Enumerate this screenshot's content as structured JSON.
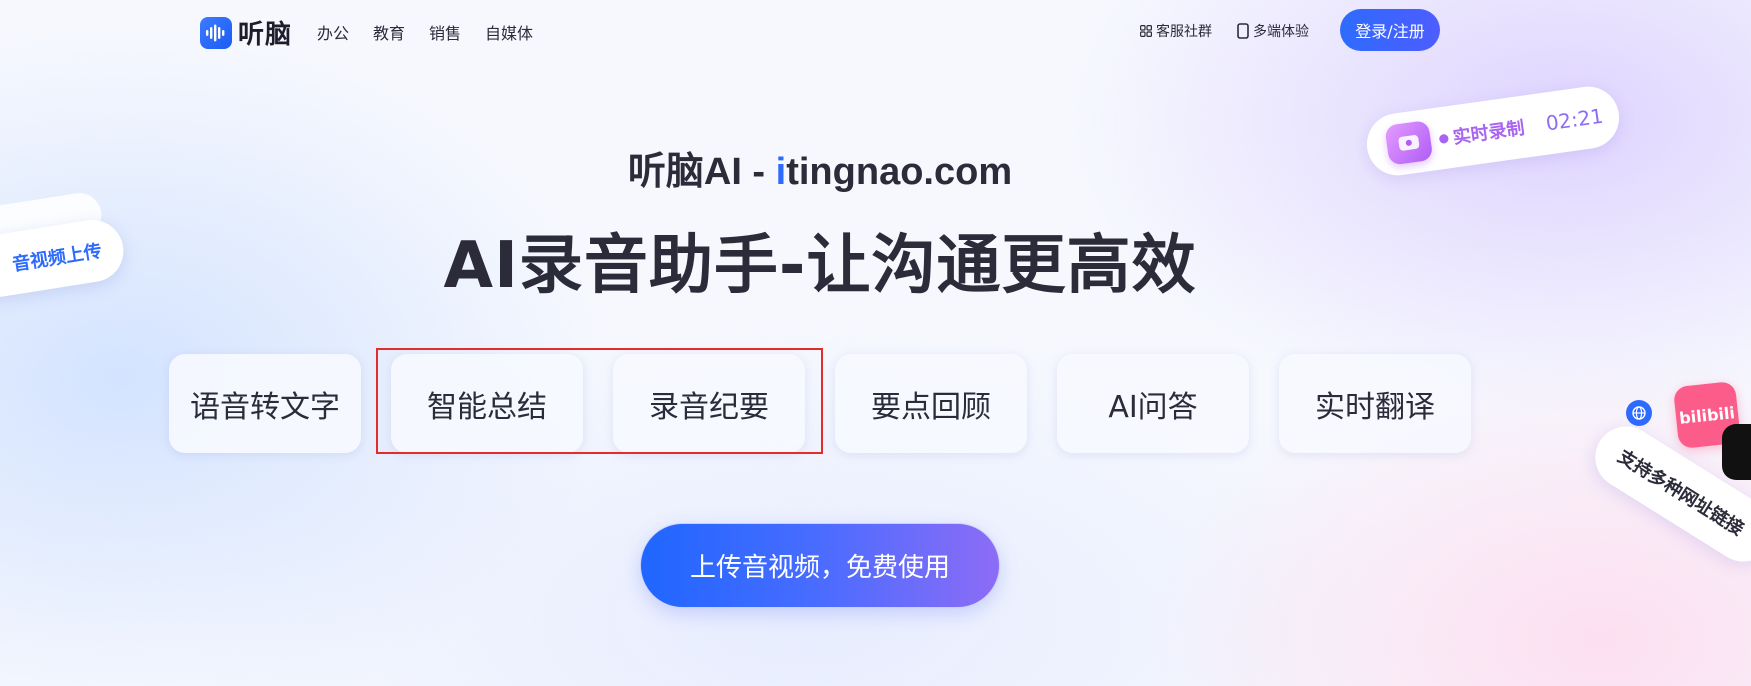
{
  "header": {
    "logo_text": "听脑",
    "nav": [
      "办公",
      "教育",
      "销售",
      "自媒体"
    ],
    "community": {
      "label": "客服社群",
      "icon": "grid-icon"
    },
    "multi_device": {
      "label": "多端体验",
      "icon": "phone-icon"
    },
    "login_label": "登录/注册"
  },
  "hero": {
    "site_title_prefix": "听脑AI - ",
    "site_title_accent": "i",
    "site_title_rest": "tingnao.com",
    "headline": "AI录音助手-让沟通更高效"
  },
  "features": [
    {
      "label": "语音转文字"
    },
    {
      "label": "智能总结"
    },
    {
      "label": "录音纪要"
    },
    {
      "label": "要点回顾"
    },
    {
      "label": "AI问答"
    },
    {
      "label": "实时翻译"
    }
  ],
  "cta_label": "上传音视频，免费使用",
  "floats": {
    "upload_label": "音视频上传",
    "record_label": "实时录制",
    "record_time": "02:21",
    "links_label": "支持多种网址链接",
    "bili_text": "bilibili"
  },
  "colors": {
    "accent": "#2d6bff",
    "highlight_border": "#e62b2b",
    "record_purple": "#a865f0"
  }
}
